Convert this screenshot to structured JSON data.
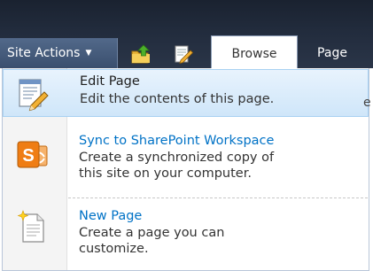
{
  "toolbar": {
    "site_actions_label": "Site Actions",
    "tabs": [
      {
        "label": "Browse",
        "selected": true
      },
      {
        "label": "Page",
        "selected": false
      }
    ]
  },
  "menu": {
    "items": [
      {
        "title": "Edit Page",
        "description": [
          "Edit the contents of this page."
        ],
        "icon": "edit-page-icon",
        "highlighted": true
      },
      {
        "title": "Sync to SharePoint Workspace",
        "description": [
          "Create a synchronized copy of",
          "this site on your computer."
        ],
        "icon": "sharepoint-workspace-icon",
        "highlighted": false
      },
      {
        "title": "New Page",
        "description": [
          "Create a page you can",
          "customize."
        ],
        "icon": "new-page-icon",
        "highlighted": false
      }
    ]
  },
  "colors": {
    "topbar": "#222c3d",
    "site_actions_bg": "#3f5474",
    "link_blue": "#0072c6",
    "highlight_bg": "#d8ebfa",
    "highlight_border": "#a8d1f2"
  }
}
